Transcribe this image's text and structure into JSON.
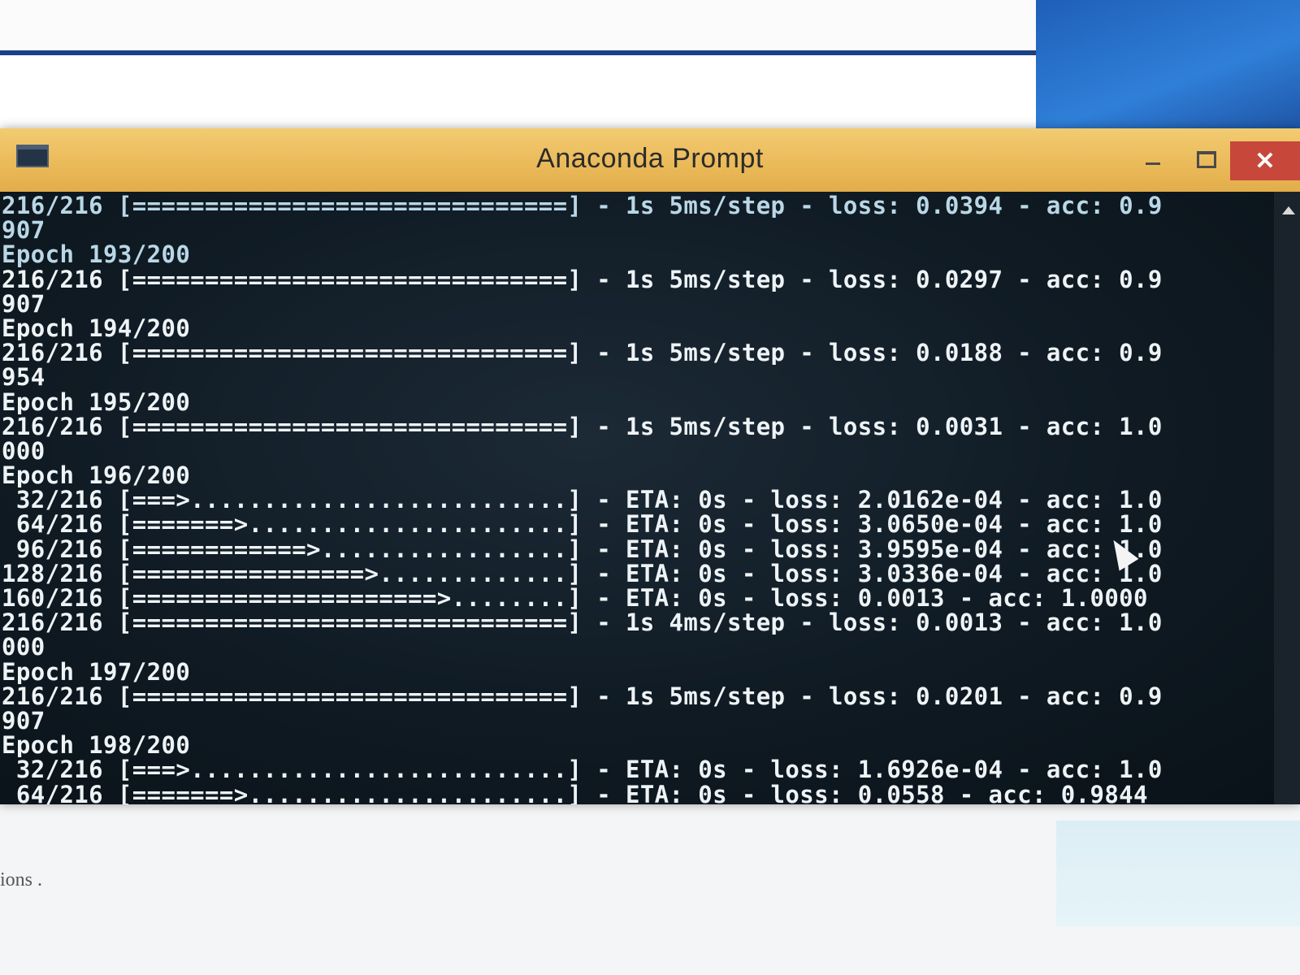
{
  "window": {
    "title": "Anaconda Prompt",
    "close_glyph": "✕"
  },
  "console": {
    "lines": [
      "216/216 [==============================] - 1s 5ms/step - loss: 0.0394 - acc: 0.9",
      "907",
      "Epoch 193/200",
      "216/216 [==============================] - 1s 5ms/step - loss: 0.0297 - acc: 0.9",
      "907",
      "Epoch 194/200",
      "216/216 [==============================] - 1s 5ms/step - loss: 0.0188 - acc: 0.9",
      "954",
      "Epoch 195/200",
      "216/216 [==============================] - 1s 5ms/step - loss: 0.0031 - acc: 1.0",
      "000",
      "Epoch 196/200",
      " 32/216 [===>..........................] - ETA: 0s - loss: 2.0162e-04 - acc: 1.0",
      " 64/216 [=======>......................] - ETA: 0s - loss: 3.0650e-04 - acc: 1.0",
      " 96/216 [============>.................] - ETA: 0s - loss: 3.9595e-04 - acc: 1.0",
      "128/216 [================>.............] - ETA: 0s - loss: 3.0336e-04 - acc: 1.0",
      "160/216 [=====================>........] - ETA: 0s - loss: 0.0013 - acc: 1.0000",
      "216/216 [==============================] - 1s 4ms/step - loss: 0.0013 - acc: 1.0",
      "000",
      "Epoch 197/200",
      "216/216 [==============================] - 1s 5ms/step - loss: 0.0201 - acc: 0.9",
      "907",
      "Epoch 198/200",
      " 32/216 [===>..........................] - ETA: 0s - loss: 1.6926e-04 - acc: 1.0",
      " 64/216 [=======>......................] - ETA: 0s - loss: 0.0558 - acc: 0.9844"
    ]
  },
  "background": {
    "bottom_text": "ions ."
  }
}
